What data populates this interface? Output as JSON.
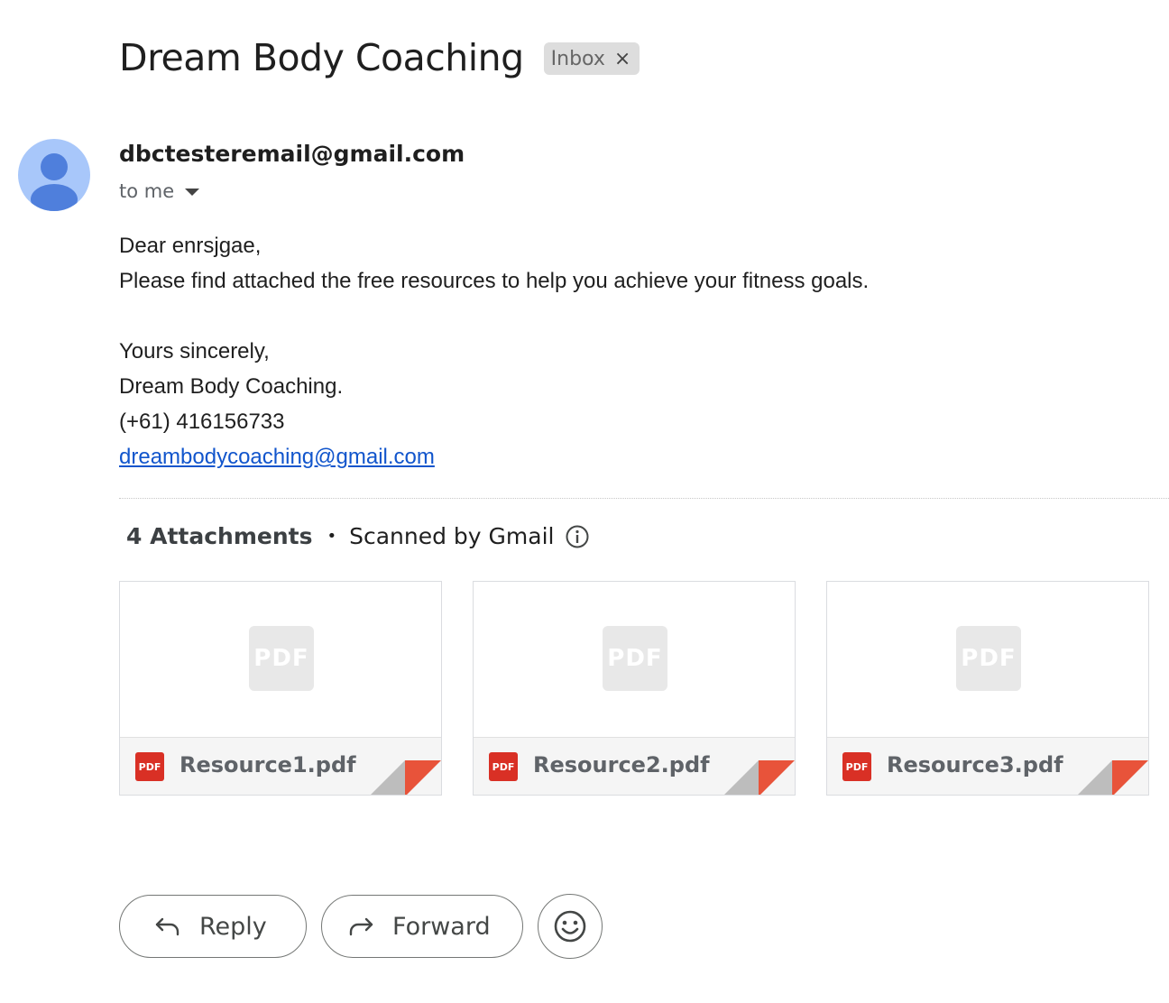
{
  "email": {
    "subject": "Dream Body Coaching",
    "label_chip": {
      "label": "Inbox",
      "remove_symbol": "×"
    },
    "sender": "dbctesteremail@gmail.com",
    "recipient": "to me",
    "body": {
      "greeting": "Dear enrsjgae,",
      "message": "Please find attached the free resources to help you achieve your fitness goals.",
      "closing": "Yours sincerely,",
      "signature_name": "Dream Body Coaching.",
      "signature_phone": "(+61) 416156733",
      "signature_email": "dreambodycoaching@gmail.com"
    }
  },
  "attachments": {
    "count_label": "4 Attachments",
    "separator": "•",
    "scanned_label": "Scanned by Gmail",
    "preview_badge": "PDF",
    "file_badge": "PDF",
    "files": [
      {
        "name": "Resource1.pdf"
      },
      {
        "name": "Resource2.pdf"
      },
      {
        "name": "Resource3.pdf"
      }
    ]
  },
  "actions": {
    "reply_label": "Reply",
    "forward_label": "Forward",
    "emoji_icon": "smiley-icon"
  },
  "colors": {
    "avatar_background": "#a8c7fa",
    "avatar_figure": "#4f7fdc",
    "pdf_red": "#d93025",
    "corner_fold": "#e8533a",
    "link": "#1155cc"
  }
}
